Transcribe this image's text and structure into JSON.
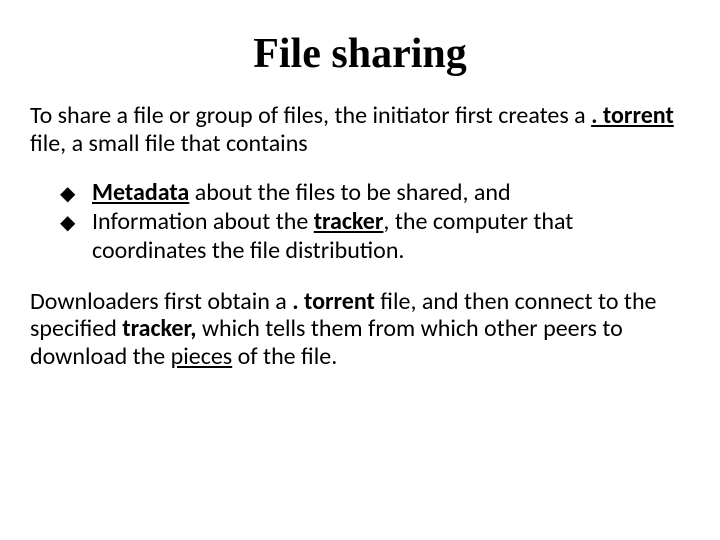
{
  "title": "File sharing",
  "intro": {
    "t1": "To share a file or group of files, the initiator first creates a ",
    "torrent": ". torrent",
    "t2": " file, a small file that contains"
  },
  "bullets": {
    "b1": {
      "metadata": "Metadata",
      "rest": " about the files to be shared, and"
    },
    "b2": {
      "lead": "Information about the ",
      "tracker": "tracker",
      "rest": ", the computer that coordinates the file distribution."
    }
  },
  "outro": {
    "t1": "Downloaders first obtain a ",
    "torrent": ". torrent",
    "t2": " file, and then connect to the specified ",
    "tracker": "tracker,",
    "t3": " which tells them from which other peers to download the ",
    "pieces": "pieces",
    "t4": " of the file."
  },
  "marker": "◆"
}
